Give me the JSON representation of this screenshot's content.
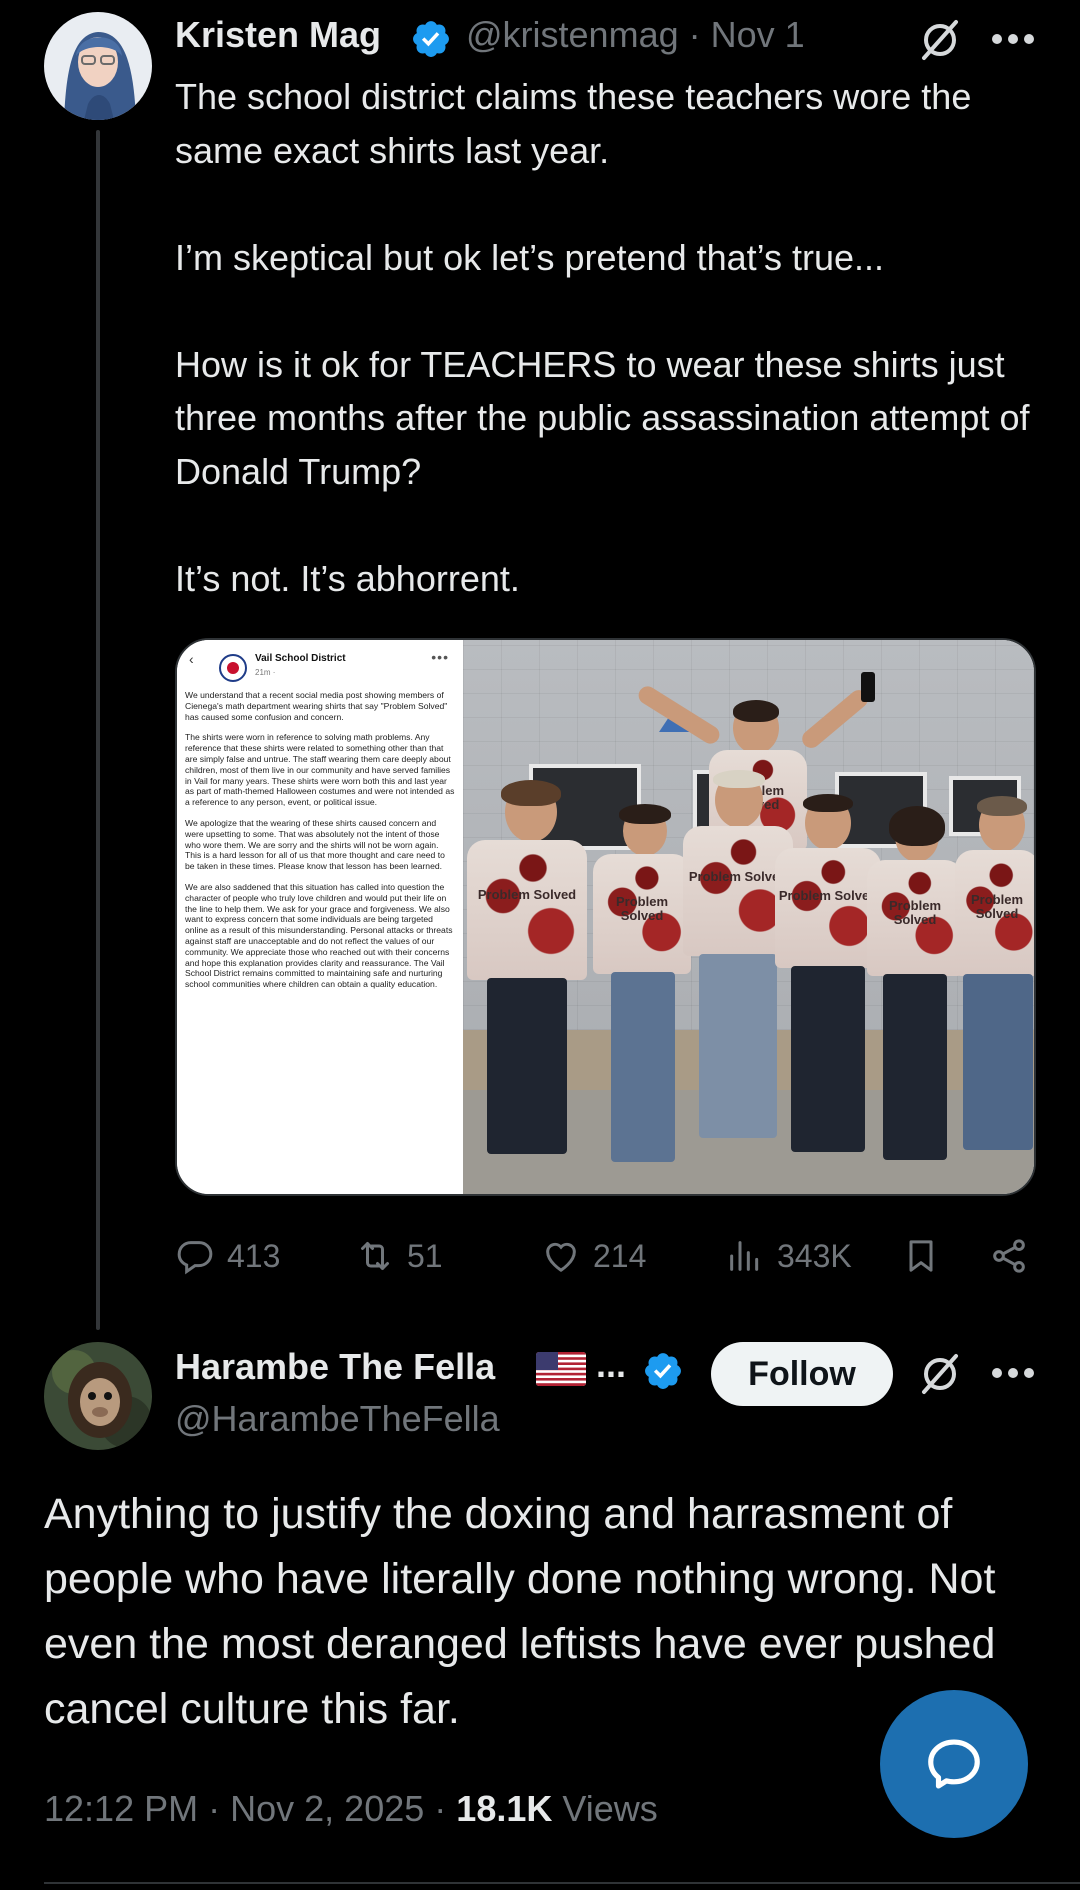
{
  "tweet1": {
    "author_name": "Kristen Mag",
    "handle": "@kristenmag",
    "separator": "·",
    "date": "Nov 1",
    "paragraphs": [
      "The school district claims these teachers wore the same exact shirts last year.",
      "I’m skeptical but ok let’s pretend that’s true...",
      "How is it ok for TEACHERS to wear these shirts just three months after the public assassination attempt of Donald Trump?",
      "It’s not. It’s abhorrent."
    ],
    "media": {
      "doc_org": "Vail School District",
      "doc_time": "21m · ",
      "doc_paragraphs": [
        "We understand that a recent social media post showing members of Cienega's math department wearing shirts that say \"Problem Solved\" has caused some confusion and concern.",
        "The shirts were worn in reference to solving math problems. Any reference that these shirts were related to something other than that are simply false and untrue. The staff wearing them care deeply about children, most of them live in our community and have served families in Vail for many years. These shirts were worn both this and last year as part of math-themed Halloween costumes and were not intended as a reference to any person, event, or political issue.",
        "We apologize that the wearing of these shirts caused concern and were upsetting to some. That was absolutely not the intent of those who wore them. We are sorry and the shirts will not be worn again. This is a hard lesson for all of us that more thought and care need to be taken in these times. Please know that lesson has been learned.",
        "We are also saddened that this situation has called into question the character of people who truly love children and would put their life on the line to help them. We ask for your grace and forgiveness. We also want to express concern that some individuals are being targeted online as a result of this misunderstanding. Personal attacks or threats against staff are unacceptable and do not reflect the values of our community. We appreciate those who reached out with their concerns and hope this explanation provides clarity and reassurance. The Vail School District remains committed to maintaining safe and nurturing school communities where children can obtain a quality education."
      ],
      "shirt_text": "Problem Solved"
    },
    "actions": {
      "replies": "413",
      "reposts": "51",
      "likes": "214",
      "views": "343K"
    }
  },
  "tweet2": {
    "author_name": "Harambe The Fella",
    "ellipsis": "...",
    "handle": "@HarambeTheFella",
    "follow_label": "Follow",
    "body": "Anything to justify the doxing and harrasment of people who have literally done nothing wrong. Not even the most deranged leftists have ever pushed cancel culture this far.",
    "time": "12:12 PM",
    "date": "Nov 2, 2025",
    "views_count": "18.1K",
    "views_label": "Views",
    "sep": "·"
  },
  "icons": {
    "verified": "verified-badge-icon",
    "grok": "grok-icon",
    "more": "more-icon",
    "reply": "reply-icon",
    "repost": "repost-icon",
    "like": "like-icon",
    "views": "views-icon",
    "bookmark": "bookmark-icon",
    "share": "share-icon",
    "compose_reply": "compose-reply-icon",
    "flag": "us-flag-icon"
  },
  "colors": {
    "background": "#000000",
    "text": "#e7e9ea",
    "muted": "#71767b",
    "verified": "#1d9bf0",
    "fab": "#1d6fb0"
  }
}
